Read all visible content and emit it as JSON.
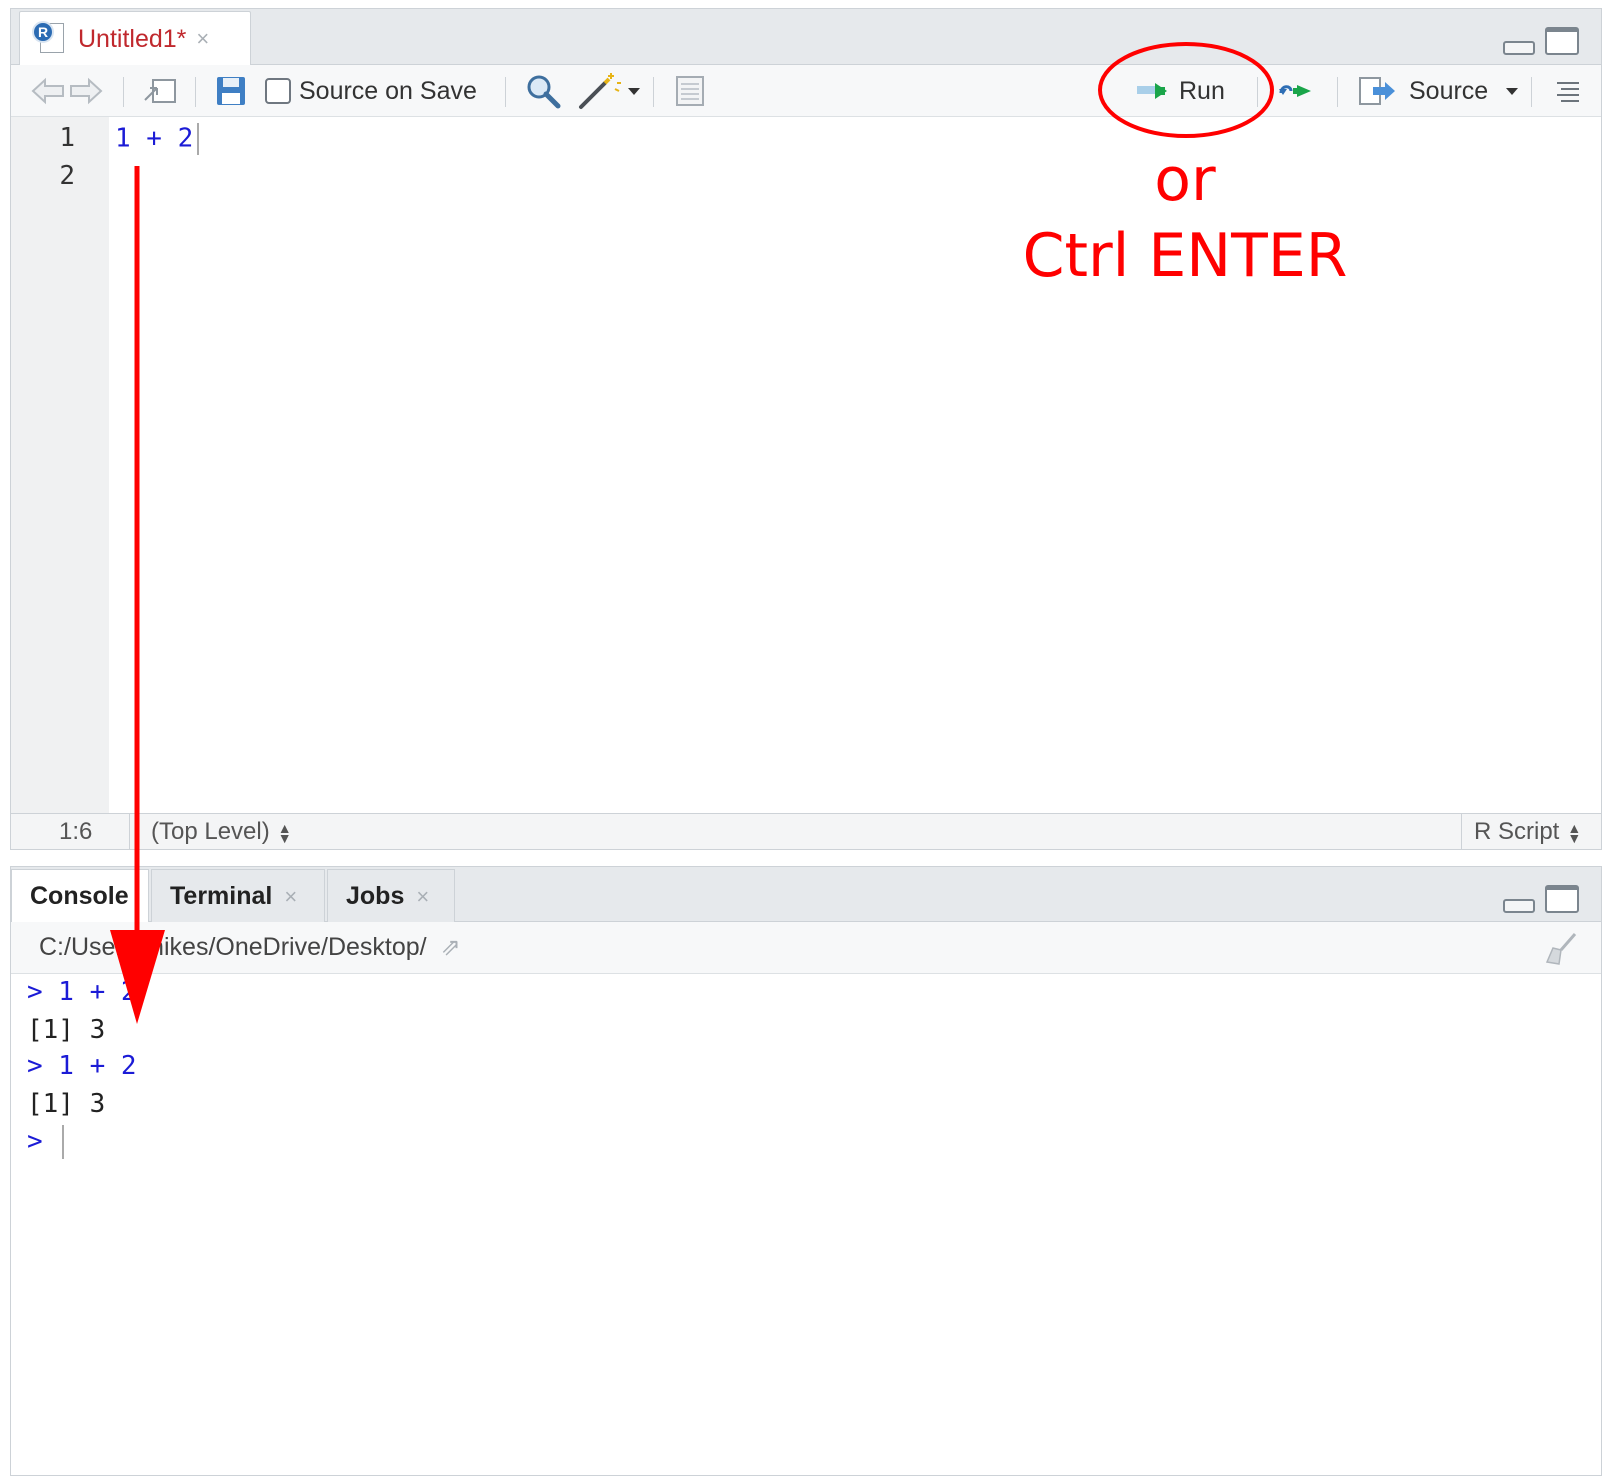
{
  "editor": {
    "tab": {
      "title": "Untitled1*",
      "close": "×",
      "badge": "R"
    },
    "toolbar": {
      "source_on_save": "Source on Save",
      "run": "Run",
      "source": "Source"
    },
    "lines": [
      {
        "number": "1",
        "code": "1 + 2"
      },
      {
        "number": "2",
        "code": ""
      }
    ],
    "status": {
      "position": "1:6",
      "scope": "(Top Level)",
      "file_type": "R Script"
    }
  },
  "console": {
    "tabs": [
      {
        "label": "Console",
        "active": true
      },
      {
        "label": "Terminal",
        "close": "×"
      },
      {
        "label": "Jobs",
        "close": "×"
      }
    ],
    "path": "C:/Users/mikes/OneDrive/Desktop/",
    "lines": [
      {
        "type": "input",
        "text": "> 1 + 2"
      },
      {
        "type": "output",
        "text": "[1] 3"
      },
      {
        "type": "input",
        "text": "> 1 + 2"
      },
      {
        "type": "output",
        "text": "[1] 3"
      },
      {
        "type": "input",
        "text": ">"
      }
    ]
  },
  "annotation": {
    "line1": "or",
    "line2": "Ctrl ENTER",
    "color": "#ff0000"
  },
  "colors": {
    "code_blue": "#1b1bd6",
    "modified_red": "#c0282d",
    "run_arrow_green": "#1aa54a"
  }
}
